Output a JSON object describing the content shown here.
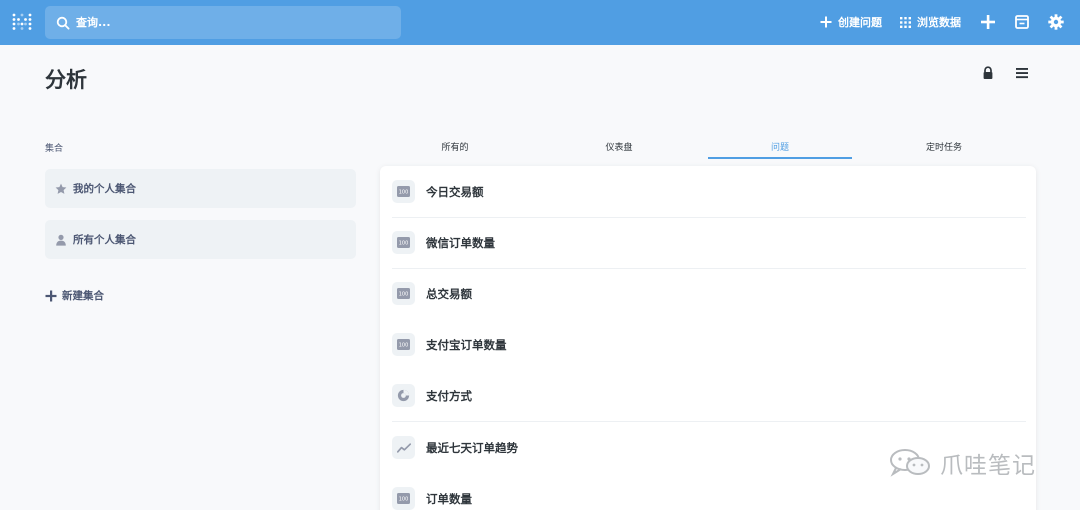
{
  "topbar": {
    "search_placeholder": "查询...",
    "create_question_label": "创建问题",
    "browse_data_label": "浏览数据"
  },
  "page": {
    "title": "分析"
  },
  "collections": {
    "section_label": "集合",
    "items": [
      {
        "label": "我的个人集合",
        "icon": "star-icon"
      },
      {
        "label": "所有个人集合",
        "icon": "person-icon"
      }
    ],
    "new_label": "新建集合"
  },
  "tabs": [
    {
      "label": "所有的",
      "active": false
    },
    {
      "label": "仪表盘",
      "active": false
    },
    {
      "label": "问题",
      "active": true
    },
    {
      "label": "定时任务",
      "active": false
    }
  ],
  "questions": [
    {
      "title": "今日交易额",
      "icon": "number-icon",
      "icon_text": "100"
    },
    {
      "title": "微信订单数量",
      "icon": "number-icon",
      "icon_text": "100"
    },
    {
      "title": "总交易额",
      "icon": "number-icon",
      "icon_text": "100"
    },
    {
      "title": "支付宝订单数量",
      "icon": "number-icon",
      "icon_text": "100"
    },
    {
      "title": "支付方式",
      "icon": "pie-icon",
      "icon_text": ""
    },
    {
      "title": "最近七天订单趋势",
      "icon": "line-icon",
      "icon_text": ""
    },
    {
      "title": "订单数量",
      "icon": "number-icon",
      "icon_text": "100"
    }
  ],
  "watermark": {
    "text": "爪哇笔记"
  },
  "colors": {
    "brand": "#509ee3",
    "text": "#2e353b",
    "muted": "#4c5773",
    "background": "#f8f9fb"
  }
}
